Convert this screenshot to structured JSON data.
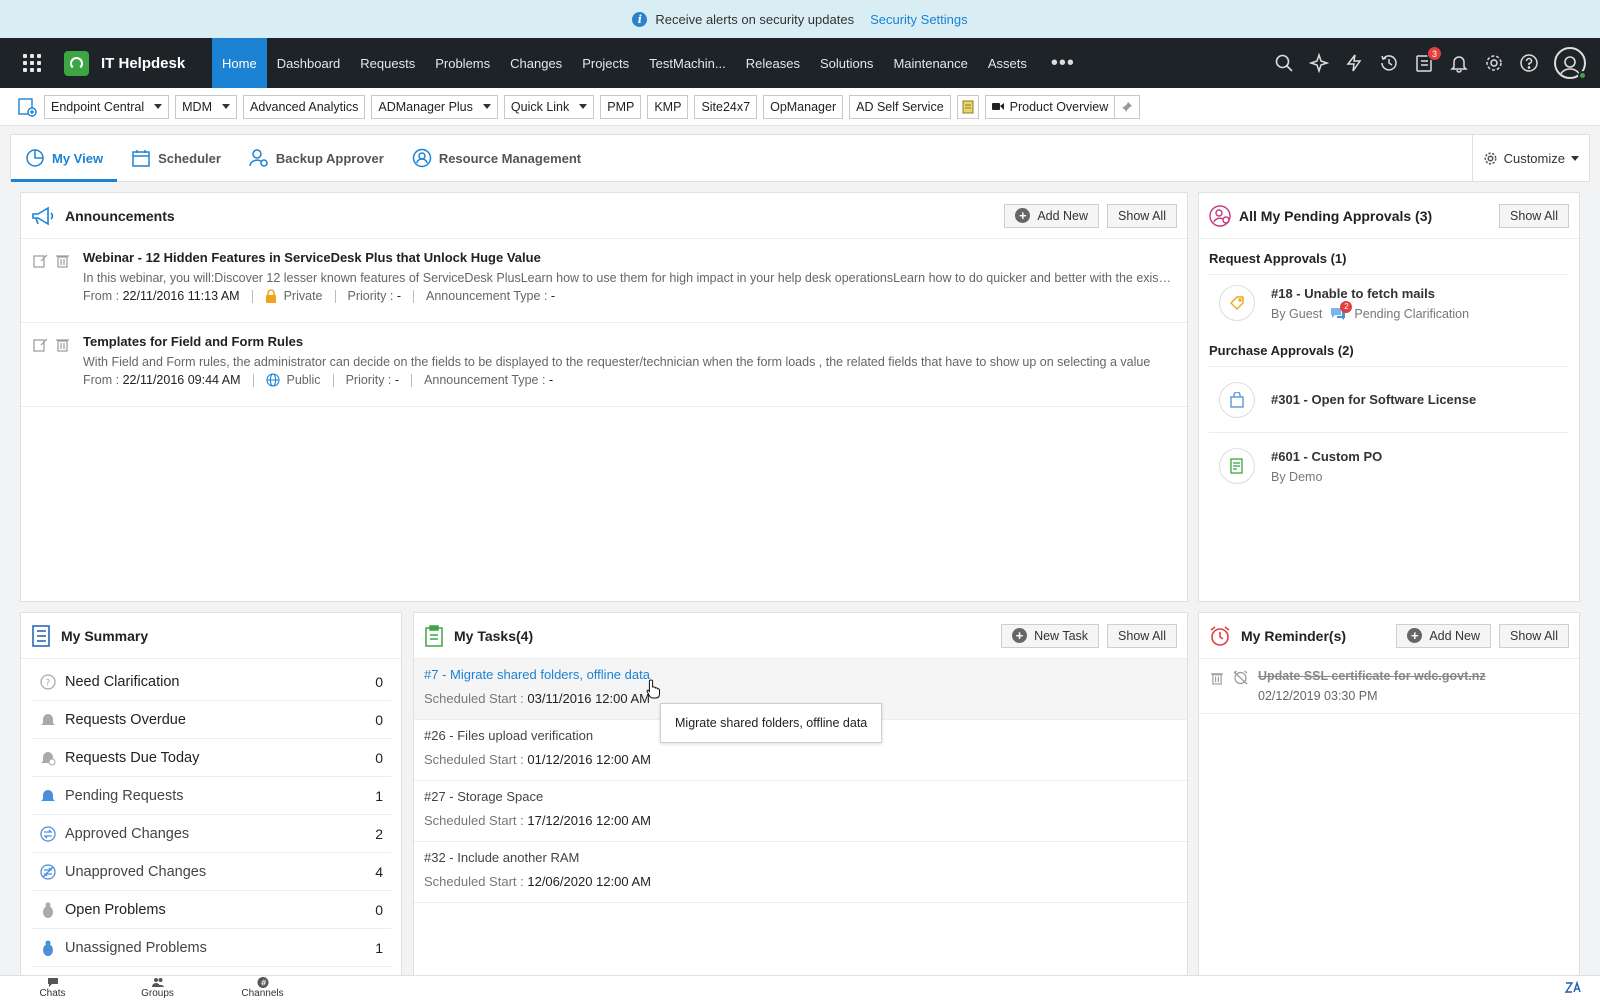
{
  "alert": {
    "text": "Receive alerts on security updates",
    "link": "Security Settings"
  },
  "nav": {
    "brand": "IT Helpdesk",
    "tabs": [
      "Home",
      "Dashboard",
      "Requests",
      "Problems",
      "Changes",
      "Projects",
      "TestMachin...",
      "Releases",
      "Solutions",
      "Maintenance",
      "Assets"
    ],
    "active_tab": "Home",
    "more": "•••",
    "task_badge": "3"
  },
  "quickbar": {
    "items": [
      "Endpoint Central",
      "MDM",
      "Advanced Analytics",
      "ADManager Plus",
      "Quick Link",
      "PMP",
      "KMP",
      "Site24x7",
      "OpManager",
      "AD Self Service"
    ],
    "product_overview": "Product Overview"
  },
  "viewtabs": {
    "tabs": [
      "My View",
      "Scheduler",
      "Backup Approver",
      "Resource Management"
    ],
    "customize": "Customize"
  },
  "announcements": {
    "title": "Announcements",
    "add_new": "Add New",
    "show_all": "Show All",
    "items": [
      {
        "title": "Webinar - 12 Hidden Features in ServiceDesk Plus that Unlock Huge Value",
        "desc": "In this webinar, you will:Discover 12 lesser known features of ServiceDesk PlusLearn how to use them for high impact in your help desk operationsLearn how to do quicker and better with the existing features",
        "from_label": "From :",
        "from": "22/11/2016 11:13 AM",
        "visibility": "Private",
        "priority_label": "Priority :",
        "priority": "-",
        "type_label": "Announcement Type :",
        "type": "-"
      },
      {
        "title": "Templates for Field and Form Rules",
        "desc": "With Field and Form rules, the administrator can decide on the fields to be displayed to the requester/technician when the form loads , the related fields that have to show up on selecting a value",
        "from_label": "From :",
        "from": "22/11/2016 09:44 AM",
        "visibility": "Public",
        "priority_label": "Priority :",
        "priority": "-",
        "type_label": "Announcement Type :",
        "type": "-"
      }
    ]
  },
  "approvals": {
    "title": "All My Pending Approvals (3)",
    "show_all": "Show All",
    "request_section": "Request Approvals (1)",
    "request": {
      "title": "#18 - Unable to fetch mails",
      "by": "By Guest",
      "badge": "2",
      "status": "Pending Clarification"
    },
    "purchase_section": "Purchase Approvals (2)",
    "purchases": [
      {
        "title": "#301 - Open for Software License",
        "by": ""
      },
      {
        "title": "#601 - Custom PO",
        "by": "By Demo"
      }
    ]
  },
  "summary": {
    "title": "My Summary",
    "rows": [
      {
        "label": "Need Clarification",
        "count": "0"
      },
      {
        "label": "Requests Overdue",
        "count": "0"
      },
      {
        "label": "Requests Due Today",
        "count": "0"
      },
      {
        "label": "Pending Requests",
        "count": "1"
      },
      {
        "label": "Approved Changes",
        "count": "2"
      },
      {
        "label": "Unapproved Changes",
        "count": "4"
      },
      {
        "label": "Open Problems",
        "count": "0"
      },
      {
        "label": "Unassigned Problems",
        "count": "1"
      }
    ]
  },
  "tasks": {
    "title": "My Tasks(4)",
    "new_task": "New Task",
    "show_all": "Show All",
    "start_label": "Scheduled Start :",
    "items": [
      {
        "title": "#7 - Migrate shared folders, offline data",
        "start": "03/11/2016 12:00 AM"
      },
      {
        "title": "#26 - Files upload verification",
        "start": "01/12/2016 12:00 AM"
      },
      {
        "title": "#27 - Storage Space",
        "start": "17/12/2016 12:00 AM"
      },
      {
        "title": "#32 - Include another RAM",
        "start": "12/06/2020 12:00 AM"
      }
    ],
    "tooltip": "Migrate shared folders, offline data"
  },
  "reminders": {
    "title": "My Reminder(s)",
    "add_new": "Add New",
    "show_all": "Show All",
    "items": [
      {
        "title": "Update SSL certificate for wdc.govt.nz",
        "date": "02/12/2019 03:30 PM"
      }
    ]
  },
  "bottombar": {
    "items": [
      "Chats",
      "Groups",
      "Channels"
    ]
  },
  "colors": {
    "accent": "#1c83d4",
    "nav_bg": "#1e2328",
    "alert_bg": "#d9edf4",
    "brand_green": "#3da544",
    "badge_red": "#e33f3f"
  }
}
